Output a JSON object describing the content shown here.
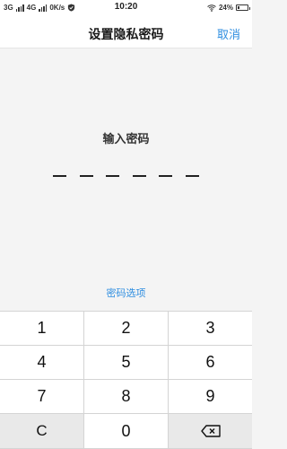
{
  "status_bar": {
    "net1": "3G",
    "net2": "4G",
    "speed": "0K/s",
    "time": "10:20",
    "battery_text": "24%",
    "battery_level": 0.24
  },
  "nav": {
    "title": "设置隐私密码",
    "cancel_label": "取消"
  },
  "main": {
    "prompt": "输入密码",
    "pin_length": 6,
    "entered_digits": 0,
    "options_link": "密码选项"
  },
  "keypad": {
    "keys": [
      "1",
      "2",
      "3",
      "4",
      "5",
      "6",
      "7",
      "8",
      "9",
      "C",
      "0",
      "backspace-icon"
    ]
  },
  "colors": {
    "accent": "#2f8ee0",
    "background": "#f4f4f4",
    "keypad_divider": "#d4d4d4",
    "function_key": "#e9e9e9"
  }
}
